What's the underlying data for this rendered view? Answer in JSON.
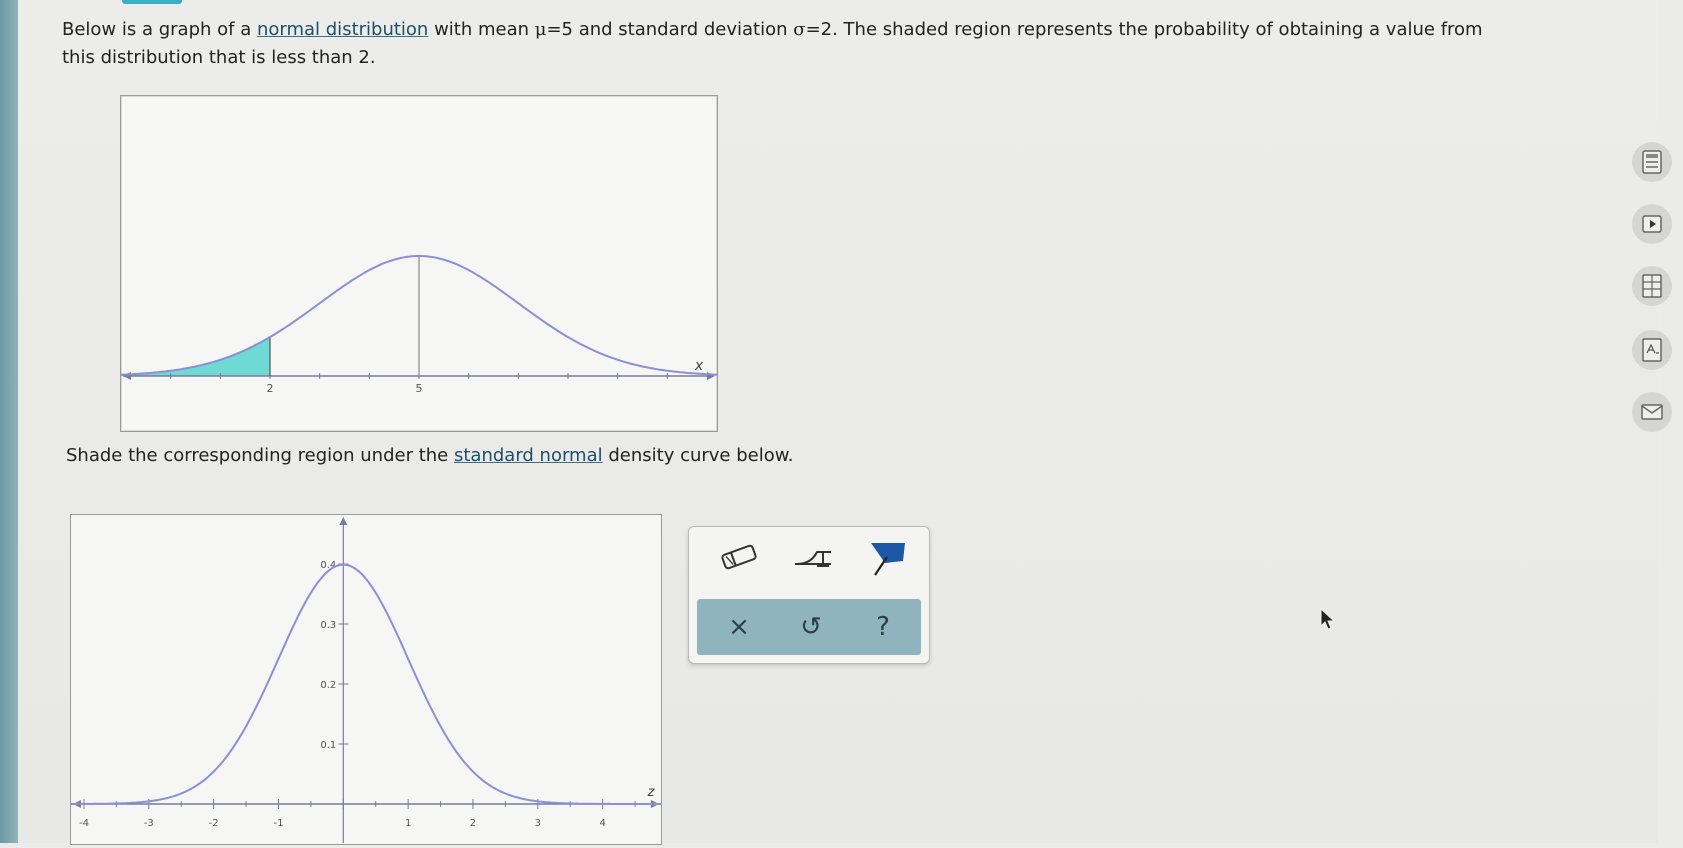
{
  "prompt": {
    "line1_before": "Below is a graph of a ",
    "link_normal": "normal distribution",
    "line1_after_link": " with mean ",
    "mu_symbol": "μ",
    "mu_value": "=5",
    "line1_mid": " and standard deviation ",
    "sigma_symbol": "σ",
    "sigma_value": "=2",
    "line1_end": ". The shaded region represents the probability of obtaining a value from",
    "line2": "this distribution that is less than 2."
  },
  "instruction": {
    "before": "Shade the corresponding region under the ",
    "link": "standard normal",
    "after": " density curve below."
  },
  "chart_data": [
    {
      "type": "area",
      "series": [
        {
          "mean": 5,
          "sd": 2,
          "shade_below": 2
        }
      ],
      "xlim": [
        -1,
        11
      ],
      "x_ticks": [
        "2",
        "5"
      ],
      "axis_label": "x",
      "color": "#8b8fd6",
      "shade_color": "#6fd9d3"
    },
    {
      "type": "line",
      "series": [
        {
          "mean": 0,
          "sd": 1
        }
      ],
      "xlim": [
        -4.2,
        4.9
      ],
      "ylim": [
        0,
        0.45
      ],
      "x_ticks": [
        "-4",
        "-3",
        "-2",
        "-1",
        "1",
        "2",
        "3",
        "4"
      ],
      "y_ticks": [
        "0.1",
        "0.2",
        "0.3",
        "0.4"
      ],
      "axis_label": "z",
      "color": "#8b8fd6"
    }
  ],
  "tools": [
    {
      "name": "eraser-tool",
      "icon": "eraser-icon"
    },
    {
      "name": "left-tail-tool",
      "icon": "tail-icon"
    },
    {
      "name": "shade-tool",
      "icon": "flag-icon"
    }
  ],
  "actions": [
    {
      "name": "clear-button",
      "label": "×"
    },
    {
      "name": "undo-button",
      "label": "↺"
    },
    {
      "name": "help-button",
      "label": "?"
    }
  ],
  "side_icons": [
    "calculator-icon",
    "video-icon",
    "table-icon",
    "textbook-icon",
    "mail-icon"
  ]
}
